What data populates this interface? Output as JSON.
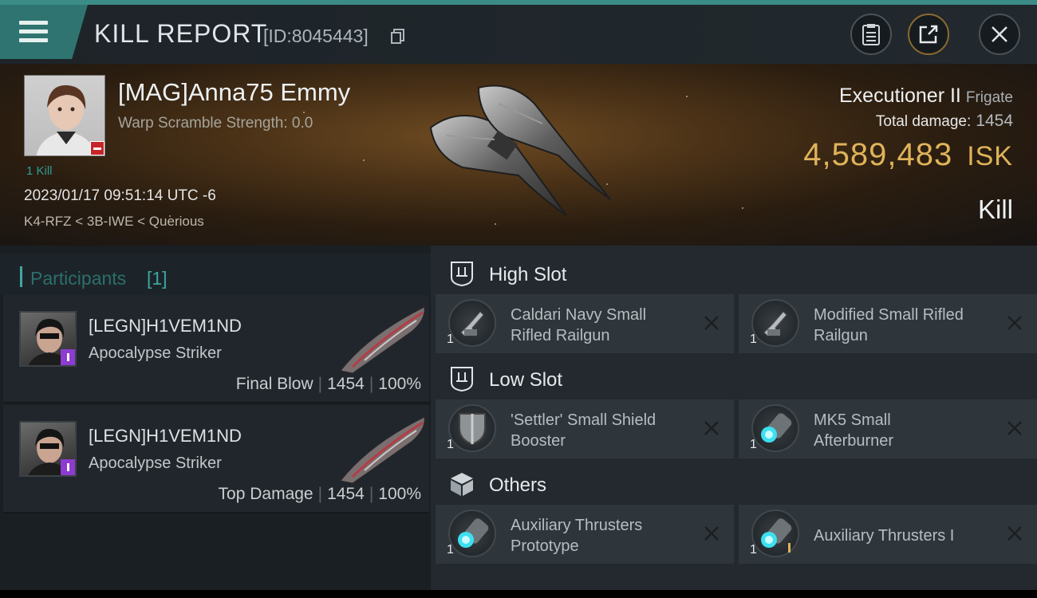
{
  "header": {
    "title": "KILL REPORT",
    "report_id": "[ID:8045443]",
    "icons": [
      "menu-icon",
      "copy-icon",
      "clipboard-icon",
      "share-icon",
      "close-icon"
    ]
  },
  "victim": {
    "pilot_name": "[MAG]Anna75 Emmy",
    "warp_scramble": "Warp Scramble Strength: 0.0",
    "kills": "1 Kill",
    "datetime": "2023/01/17 09:51:14 UTC -6",
    "location": "K4-RFZ < 3B-IWE < Querious",
    "ship_name": "Executioner II",
    "ship_class": "Frigate",
    "total_damage_label": "Total damage:",
    "total_damage": "1454",
    "isk_value": "4,589,483",
    "isk_unit": "ISK",
    "result": "Kill"
  },
  "participants": {
    "title": "Participants",
    "count": "[1]",
    "rows": [
      {
        "name": "[LEGN]H1VEM1ND",
        "ship": "Apocalypse Striker",
        "role": "Final Blow",
        "damage": "1454",
        "percent": "100%"
      },
      {
        "name": "[LEGN]H1VEM1ND",
        "ship": "Apocalypse Striker",
        "role": "Top Damage",
        "damage": "1454",
        "percent": "100%"
      }
    ]
  },
  "fitting": {
    "high_slot": {
      "title": "High Slot",
      "items": [
        {
          "name_l1": "Caldari Navy Small",
          "name_l2": "Rifled Railgun",
          "qty": "1",
          "icon": "railgun-icon"
        },
        {
          "name_l1": "Modified Small Rifled",
          "name_l2": "Railgun",
          "qty": "1",
          "icon": "railgun-icon"
        }
      ]
    },
    "low_slot": {
      "title": "Low Slot",
      "items": [
        {
          "name_l1": "'Settler' Small Shield",
          "name_l2": "Booster",
          "qty": "1",
          "icon": "shield-booster-icon"
        },
        {
          "name_l1": "MK5 Small",
          "name_l2": "Afterburner",
          "qty": "1",
          "icon": "afterburner-icon"
        }
      ]
    },
    "others": {
      "title": "Others",
      "items": [
        {
          "name_l1": "Auxiliary Thrusters",
          "name_l2": "Prototype",
          "qty": "1",
          "icon": "thruster-icon"
        },
        {
          "name_l1": "Auxiliary Thrusters I",
          "name_l2": "",
          "qty": "1",
          "icon": "thruster-icon"
        }
      ]
    }
  },
  "colors": {
    "accent": "#3b8c86",
    "isk": "#e0b35a",
    "badge_red": "#c6252a",
    "badge_purple": "#8d3bd1"
  }
}
